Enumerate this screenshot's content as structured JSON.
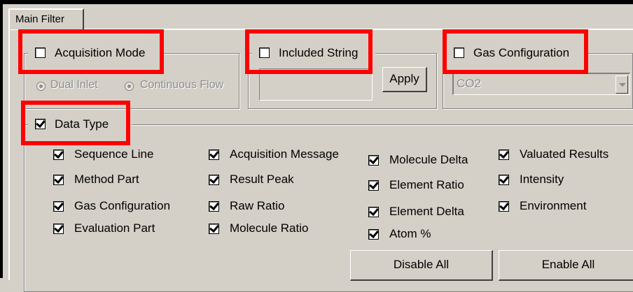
{
  "tab": {
    "label": "Main Filter"
  },
  "acquisition_mode": {
    "label": "Acquisition Mode",
    "checked": false,
    "options": [
      "Dual Inlet",
      "Continuous Flow"
    ]
  },
  "included_string": {
    "label": "Included String",
    "checked": false,
    "value": "",
    "apply_label": "Apply"
  },
  "gas_configuration": {
    "label": "Gas Configuration",
    "checked": false,
    "selected": "CO2"
  },
  "data_type": {
    "label": "Data Type",
    "checked": true,
    "columns": [
      [
        "Sequence Line",
        "Method Part",
        "Gas Configuration",
        "Evaluation Part"
      ],
      [
        "Acquisition Message",
        "Result Peak",
        "Raw Ratio",
        "Molecule Ratio"
      ],
      [
        "Molecule Delta",
        "Element Ratio",
        "Element Delta",
        "Atom %"
      ],
      [
        "Valuated Results",
        "Intensity",
        "Environment"
      ]
    ],
    "disable_all_label": "Disable All",
    "enable_all_label": "Enable All"
  },
  "colors": {
    "highlight": "#ff0000",
    "background": "#d4d0c8"
  }
}
